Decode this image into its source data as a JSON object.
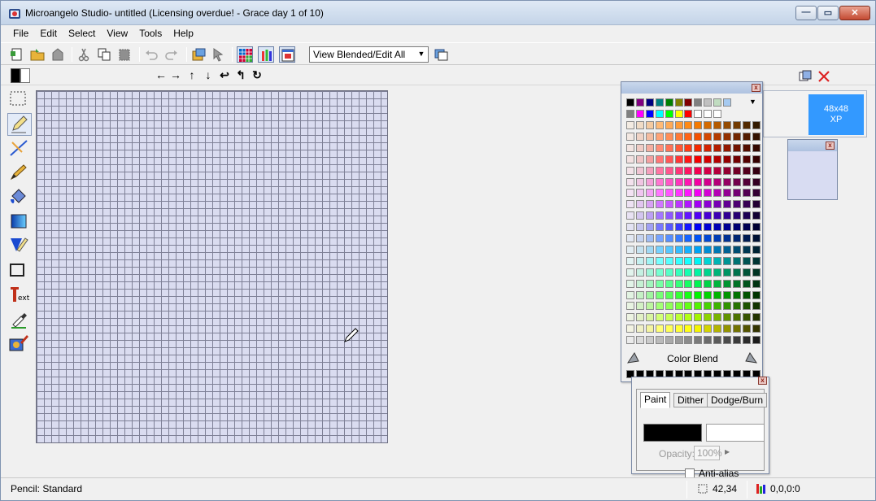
{
  "window": {
    "title": "Microangelo Studio- untitled  (Licensing overdue! - Grace day 1 of 10)",
    "minimize_glyph": "—",
    "maximize_glyph": "▭",
    "close_glyph": "✕"
  },
  "menu": {
    "items": [
      {
        "label": "File"
      },
      {
        "label": "Edit"
      },
      {
        "label": "Select"
      },
      {
        "label": "View"
      },
      {
        "label": "Tools"
      },
      {
        "label": "Help"
      }
    ]
  },
  "toolbar": {
    "view_mode": "View Blended/Edit All",
    "dropdown_arrow": "▼"
  },
  "shift_arrows": [
    "←",
    "→",
    "↑",
    "↓",
    "↩",
    "↰",
    "↻"
  ],
  "color_palette": {
    "blend_label": "Color Blend",
    "menu_arrow": "▼"
  },
  "brush_panel": {
    "tabs": [
      "Paint",
      "Dither",
      "Dodge/Burn"
    ],
    "opacity_label": "Opacity:",
    "opacity_value": "100%",
    "antialias_label": "Anti-alias",
    "spin_glyph": "▶"
  },
  "formats": {
    "item_size": "48x48",
    "item_style": "XP"
  },
  "close_glyph_small": "x",
  "status": {
    "tool": "Pencil: Standard",
    "coords": "42,34",
    "color_value": "0,0,0:0"
  },
  "colors": {
    "accent": "#3399ff",
    "canvas_bg": "#dadcf0",
    "grid_line": "#7e8096"
  }
}
